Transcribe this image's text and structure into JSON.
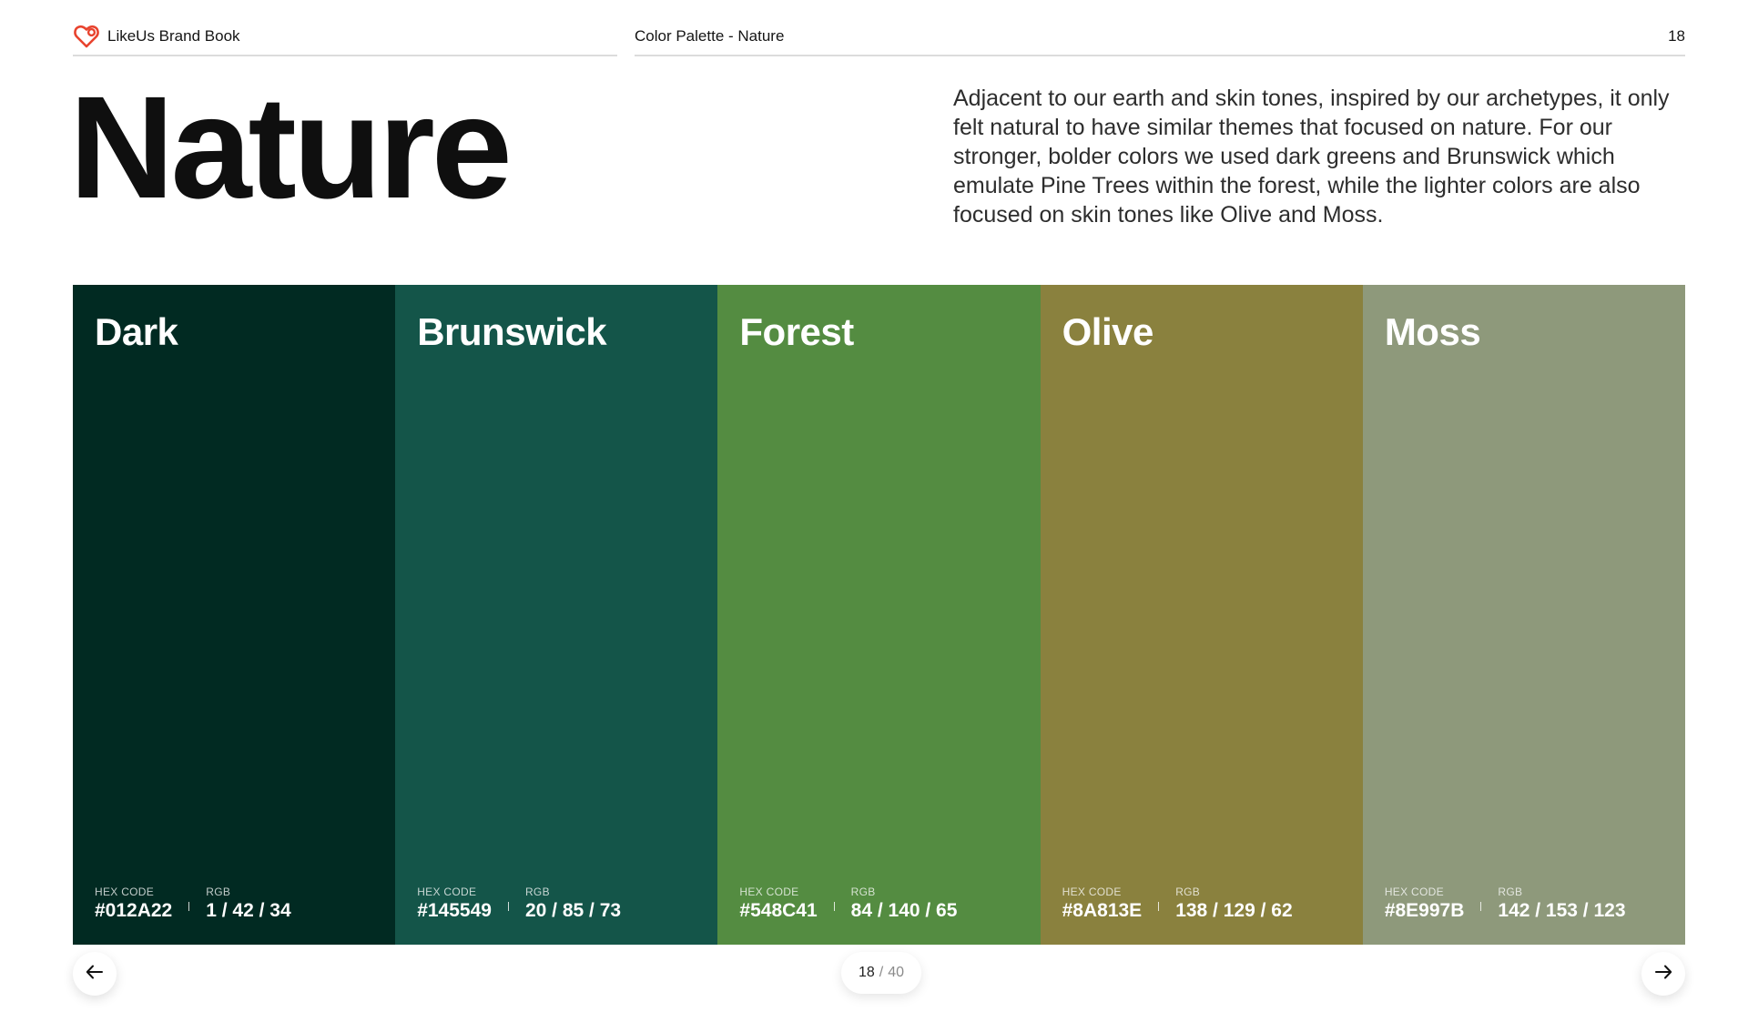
{
  "header": {
    "brand_name": "LikeUs Brand Book",
    "section_name": "Color Palette - Nature",
    "page_number": "18",
    "logo_color": "#E8432E"
  },
  "main": {
    "title": "Nature",
    "description": "Adjacent to our earth and skin tones, inspired by our archetypes, it only felt natural to have similar themes that focused on nature. For our stronger, bolder colors we used dark greens and Brunswick which emulate Pine Trees within the forest, while the lighter colors are also focused on skin tones like Olive and Moss."
  },
  "swatches": [
    {
      "name": "Dark",
      "hex_label": "HEX CODE",
      "hex": "#012A22",
      "rgb_label": "RGB",
      "rgb": "1 / 42 / 34",
      "color": "#012A22"
    },
    {
      "name": "Brunswick",
      "hex_label": "HEX CODE",
      "hex": "#145549",
      "rgb_label": "RGB",
      "rgb": "20 / 85 / 73",
      "color": "#145549"
    },
    {
      "name": "Forest",
      "hex_label": "HEX CODE",
      "hex": "#548C41",
      "rgb_label": "RGB",
      "rgb": "84 / 140 / 65",
      "color": "#548C41"
    },
    {
      "name": "Olive",
      "hex_label": "HEX CODE",
      "hex": "#8A813E",
      "rgb_label": "RGB",
      "rgb": "138 / 129 / 62",
      "color": "#8A813E"
    },
    {
      "name": "Moss",
      "hex_label": "HEX CODE",
      "hex": "#8E997B",
      "rgb_label": "RGB",
      "rgb": "142 / 153 / 123",
      "color": "#8E997B"
    }
  ],
  "pager": {
    "current": "18",
    "separator": "/",
    "total": "40"
  },
  "nav": {
    "prev_icon": "arrow-left-icon",
    "next_icon": "arrow-right-icon"
  }
}
